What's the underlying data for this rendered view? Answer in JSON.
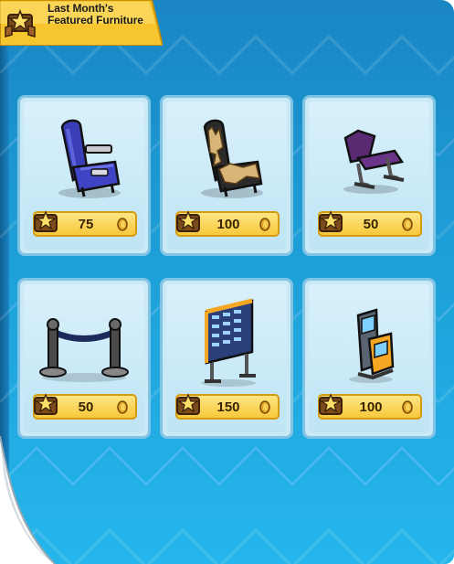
{
  "banner": {
    "icon": "member-star-icon",
    "title": "Last Month's Featured Furniture"
  },
  "items": [
    {
      "name": "blue-airplane-seat",
      "price": "75",
      "currency_icon": "coin-icon"
    },
    {
      "name": "fur-airplane-seat",
      "price": "100",
      "currency_icon": "coin-icon"
    },
    {
      "name": "purple-waiting-chair",
      "price": "50",
      "currency_icon": "coin-icon"
    },
    {
      "name": "rope-barrier",
      "price": "50",
      "currency_icon": "coin-icon"
    },
    {
      "name": "flight-info-board",
      "price": "150",
      "currency_icon": "coin-icon"
    },
    {
      "name": "check-in-kiosk",
      "price": "100",
      "currency_icon": "coin-icon"
    }
  ],
  "colors": {
    "page_blue": "#1e9fd8",
    "card_bg": "#c9e9f6",
    "price_gold": "#f8c83a",
    "banner_yellow": "#f7c52e"
  }
}
